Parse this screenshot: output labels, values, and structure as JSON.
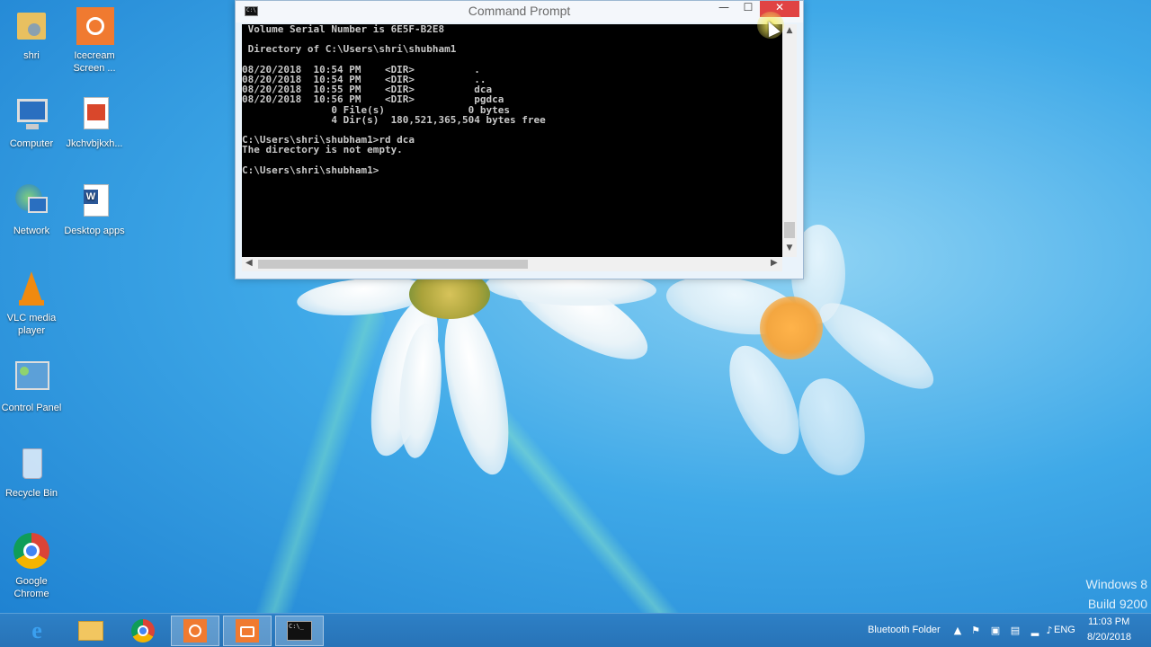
{
  "window": {
    "title": "Command Prompt",
    "sys_icon_text": "C:\\",
    "min_glyph": "—",
    "max_glyph": "☐",
    "close_glyph": "✕"
  },
  "console": {
    "lines": [
      " Volume Serial Number is 6E5F-B2E8",
      "",
      " Directory of C:\\Users\\shri\\shubham1",
      "",
      "08/20/2018  10:54 PM    <DIR>          .",
      "08/20/2018  10:54 PM    <DIR>          ..",
      "08/20/2018  10:55 PM    <DIR>          dca",
      "08/20/2018  10:56 PM    <DIR>          pgdca",
      "               0 File(s)              0 bytes",
      "               4 Dir(s)  180,521,365,504 bytes free",
      "",
      "C:\\Users\\shri\\shubham1>rd dca",
      "The directory is not empty.",
      "",
      "C:\\Users\\shri\\shubham1>"
    ]
  },
  "desktop": {
    "icons": [
      {
        "label": "shri",
        "icon": "user-folder-icon"
      },
      {
        "label": "Icecream Screen ...",
        "icon": "icecream-recorder-icon"
      },
      {
        "label": "Computer",
        "icon": "computer-icon"
      },
      {
        "label": "Jkchvbjkxh...",
        "icon": "pdf-document-icon"
      },
      {
        "label": "Network",
        "icon": "network-icon"
      },
      {
        "label": "Desktop apps",
        "icon": "word-document-icon"
      },
      {
        "label": "VLC media player",
        "icon": "vlc-icon"
      },
      {
        "label": "Control Panel",
        "icon": "control-panel-icon"
      },
      {
        "label": "Recycle Bin",
        "icon": "recycle-bin-icon"
      },
      {
        "label": "Google Chrome",
        "icon": "chrome-icon"
      }
    ]
  },
  "watermark": {
    "line1": "Windows 8",
    "line2": "Build 9200"
  },
  "taskbar": {
    "apps": [
      "internet-explorer-icon",
      "file-explorer-icon",
      "chrome-icon",
      "icecream-recorder-icon",
      "camera-app-icon",
      "command-prompt-icon"
    ],
    "cmd_icon_text": "C:\\_",
    "tray": {
      "bluetooth_label": "Bluetooth Folder",
      "language": "ENG",
      "time": "11:03 PM",
      "date": "8/20/2018"
    }
  },
  "colors": {
    "console_bg": "#000000",
    "console_text": "#c8c8c8",
    "close_button": "#e04343",
    "taskbar": "#2773b7"
  }
}
